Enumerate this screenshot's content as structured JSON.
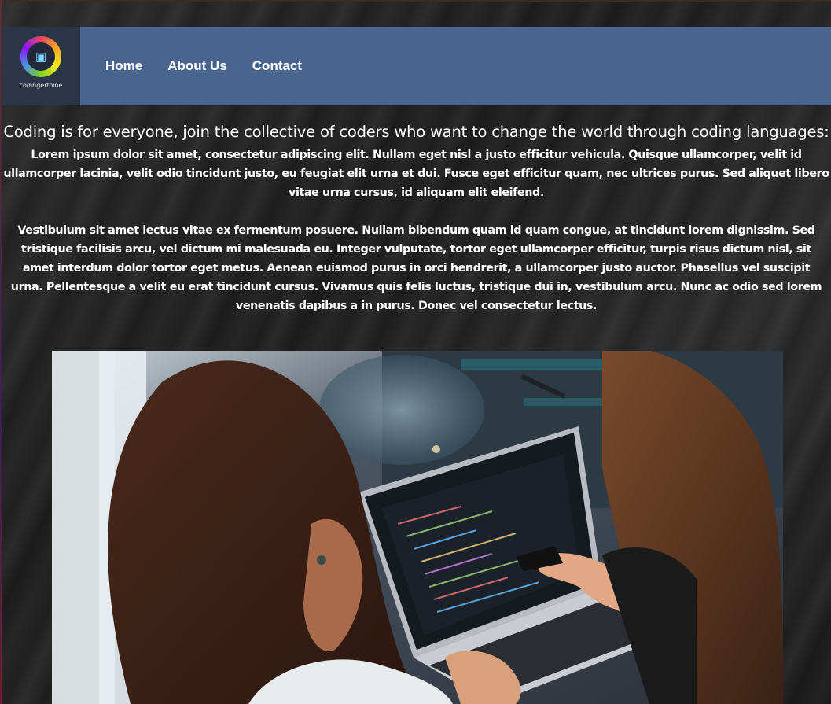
{
  "header": {
    "logo_text": "codingerfoine",
    "nav": [
      {
        "label": "Home"
      },
      {
        "label": "About Us"
      },
      {
        "label": "Contact"
      }
    ]
  },
  "main": {
    "headline": "Coding is for everyone, join the collective of coders who want to change the world through coding languages:",
    "paragraphs": [
      "Lorem ipsum dolor sit amet, consectetur adipiscing elit. Nullam eget nisl a justo efficitur vehicula. Quisque ullamcorper, velit id ullamcorper lacinia, velit odio tincidunt justo, eu feugiat elit urna et dui. Fusce eget efficitur quam, nec ultrices purus. Sed aliquet libero vitae urna cursus, id aliquam elit eleifend.",
      "Vestibulum sit amet lectus vitae ex fermentum posuere. Nullam bibendum quam id quam congue, at tincidunt lorem dignissim. Sed tristique facilisis arcu, vel dictum mi malesuada eu. Integer vulputate, tortor eget ullamcorper efficitur, turpis risus dictum nisl, sit amet interdum dolor tortor eget metus. Aenean euismod purus in orci hendrerit, a ullamcorper justo auctor. Phasellus vel suscipit urna. Pellentesque a velit eu erat tincidunt cursus. Vivamus quis felis luctus, tristique dui in, vestibulum arcu. Nunc ac odio sed lorem venenatis dapibus a in purus. Donec vel consectetur lectus."
    ]
  },
  "colors": {
    "navbar_bg": "#4a6490",
    "logo_bg": "#2c3448",
    "page_bg": "#242424",
    "text": "#ffffff"
  }
}
